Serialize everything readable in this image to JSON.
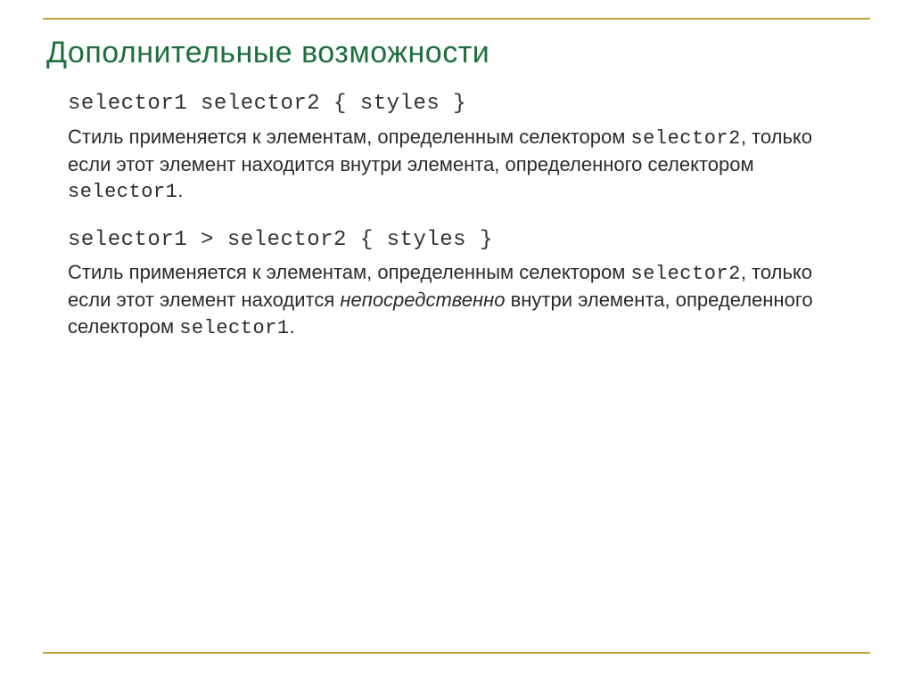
{
  "title": "Дополнительные возможности",
  "blocks": [
    {
      "code": "selector1 selector2 { styles }",
      "desc_parts": [
        {
          "t": "Стиль применяется к элементам, определенным селектором "
        },
        {
          "t": "selector2",
          "cls": "mono"
        },
        {
          "t": ", только если этот элемент находится внутри элемента, определенного селектором "
        },
        {
          "t": "selector1",
          "cls": "mono"
        },
        {
          "t": "."
        }
      ]
    },
    {
      "code": "selector1 > selector2 { styles }",
      "desc_parts": [
        {
          "t": "Стиль применяется к элементам, определенным селектором "
        },
        {
          "t": "selector2",
          "cls": "mono"
        },
        {
          "t": ", только если этот элемент находится "
        },
        {
          "t": "непосредственно",
          "cls": "italic"
        },
        {
          "t": " внутри элемента, определенного селектором "
        },
        {
          "t": "selector1",
          "cls": "mono"
        },
        {
          "t": "."
        }
      ]
    }
  ]
}
